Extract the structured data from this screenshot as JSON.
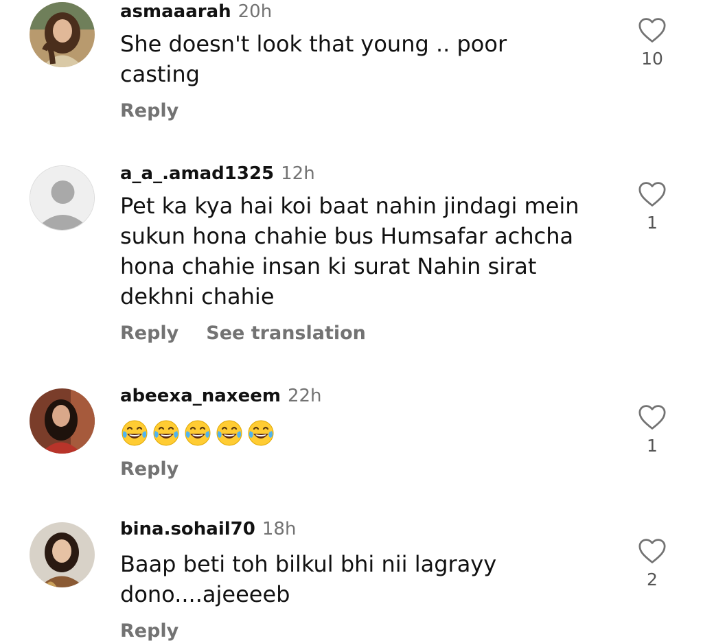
{
  "comments": [
    {
      "username": "asmaaarah",
      "time": "20h",
      "text": "She doesn't look that young .. poor\ncasting",
      "likes": "10",
      "reply_label": "Reply",
      "avatar_icon": "profile-photo"
    },
    {
      "username": "a_a_.amad1325",
      "time": "12h",
      "text": "Pet ka kya hai koi baat nahin jindagi mein\nsukun hona chahie bus Humsafar achcha\nhona chahie insan ki surat Nahin sirat\ndekhni chahie",
      "likes": "1",
      "reply_label": "Reply",
      "translate_label": "See translation",
      "avatar_icon": "default-user-icon"
    },
    {
      "username": "abeexa_naxeem",
      "time": "22h",
      "emoji": [
        "😂",
        "😂",
        "😂",
        "😂",
        "😂"
      ],
      "likes": "1",
      "reply_label": "Reply",
      "avatar_icon": "profile-photo"
    },
    {
      "username": "bina.sohail70",
      "time": "18h",
      "text": "Baap beti toh bilkul bhi nii lagrayy\ndono....ajeeeeb",
      "likes": "2",
      "reply_label": "Reply",
      "avatar_icon": "profile-photo"
    }
  ],
  "colors": {
    "text": "#111111",
    "muted": "#737373",
    "default_avatar_bg": "#efefef",
    "default_avatar_fg": "#a9a9a9"
  }
}
